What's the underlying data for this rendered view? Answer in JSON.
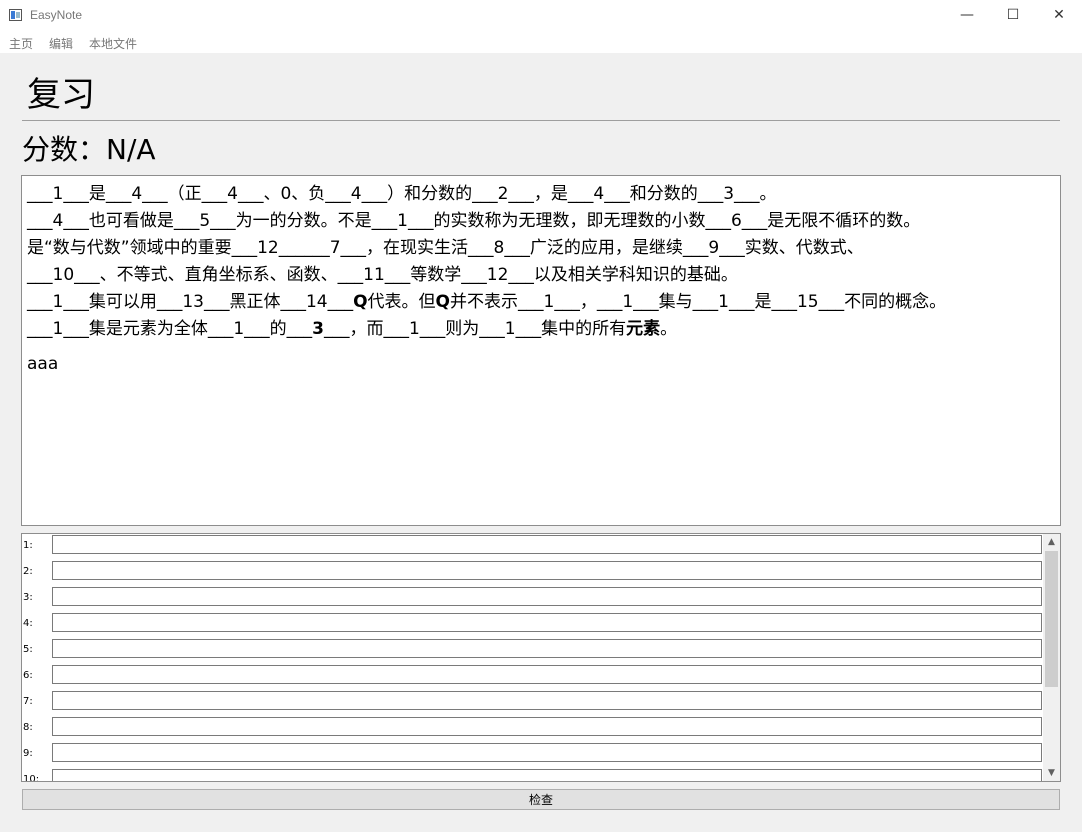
{
  "window": {
    "title": "EasyNote",
    "minimize_glyph": "—",
    "maximize_glyph": "☐",
    "close_glyph": "✕"
  },
  "menu": {
    "home": "主页",
    "edit": "编辑",
    "local_files": "本地文件"
  },
  "page": {
    "title": "复习",
    "score_label": "分数：N/A"
  },
  "editor": {
    "lines": [
      [
        {
          "t": "___1___是___4___（正___4___、0、负___4___）和分数的___2___，是___4___和分数的___3___。"
        }
      ],
      [
        {
          "t": "___4___也可看做是___5___为一的分数。不是___1___的实数称为无理数，即无理数的小数___6___是无限不循环的数。"
        }
      ],
      [
        {
          "t": "是“数与代数”领域中的重要___12______7___，在现实生活___8___广泛的应用，是继续___9___实数、代数式、"
        }
      ],
      [
        {
          "t": "___10___、不等式、直角坐标系、函数、___11___等数学___12___以及相关学科知识的基础。"
        }
      ],
      [
        {
          "t": "___1___集可以用___13___黑正体___14___"
        },
        {
          "t": "Q",
          "b": true
        },
        {
          "t": "代表。但"
        },
        {
          "t": "Q",
          "b": true
        },
        {
          "t": "并不表示___1___，___1___集与___1___是___15___不同的概念。"
        }
      ],
      [
        {
          "t": "___1___集是元素为全体___1___的___"
        },
        {
          "t": "3",
          "b": true
        },
        {
          "t": "___，而___1___则为___1___集中的所有"
        },
        {
          "t": "元素",
          "b": true
        },
        {
          "t": "。"
        }
      ]
    ],
    "extra_text": "aaa"
  },
  "answers": {
    "rows": [
      {
        "label": "1:",
        "value": ""
      },
      {
        "label": "2:",
        "value": ""
      },
      {
        "label": "3:",
        "value": ""
      },
      {
        "label": "4:",
        "value": ""
      },
      {
        "label": "5:",
        "value": ""
      },
      {
        "label": "6:",
        "value": ""
      },
      {
        "label": "7:",
        "value": ""
      },
      {
        "label": "8:",
        "value": ""
      },
      {
        "label": "9:",
        "value": ""
      },
      {
        "label": "10:",
        "value": ""
      }
    ],
    "scroll_up_glyph": "▲",
    "scroll_down_glyph": "▼"
  },
  "check_button_label": "检查"
}
